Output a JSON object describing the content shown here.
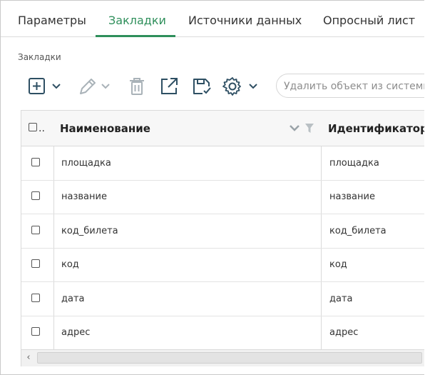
{
  "tabs": [
    {
      "label": "Параметры",
      "active": false
    },
    {
      "label": "Закладки",
      "active": true
    },
    {
      "label": "Источники данных",
      "active": false
    },
    {
      "label": "Опросный лист",
      "active": false
    }
  ],
  "section_title": "Закладки",
  "toolbar": {
    "icons": [
      "add-icon",
      "edit-icon",
      "delete-icon",
      "open-external-icon",
      "save-icon",
      "settings-icon"
    ],
    "search_placeholder": "Удалить объект из системы",
    "accent_color": "#2f8f5b"
  },
  "grid": {
    "select_all_label": "..",
    "columns": [
      "Наименование",
      "Идентификатор"
    ],
    "rows": [
      {
        "name": "площадка",
        "id": "площадка"
      },
      {
        "name": "название",
        "id": "название"
      },
      {
        "name": "код_билета",
        "id": "код_билета"
      },
      {
        "name": "код",
        "id": "код"
      },
      {
        "name": "дата",
        "id": "дата"
      },
      {
        "name": "адрес",
        "id": "адрес"
      }
    ]
  }
}
